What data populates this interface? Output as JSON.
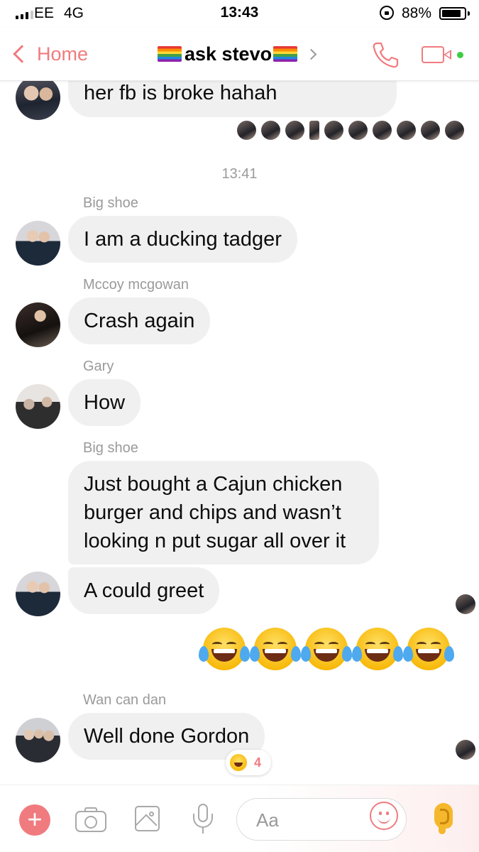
{
  "status_bar": {
    "carrier": "EE",
    "network": "4G",
    "time": "13:43",
    "battery": "88%",
    "battery_level": 0.88
  },
  "header": {
    "back_label": "Home",
    "title": "ask stevo",
    "accent_color": "#f07b7f",
    "online_color": "#3fcc45"
  },
  "chat": {
    "timestamp": "13:41",
    "messages": [
      {
        "sender": "",
        "text": "her fb is broke hahah"
      },
      {
        "sender": "Big shoe",
        "text": "I am a ducking tadger"
      },
      {
        "sender": "Mccoy mcgowan",
        "text": "Crash again"
      },
      {
        "sender": "Gary",
        "text": "How"
      },
      {
        "sender": "Big shoe",
        "text": "Just bought a Cajun chicken burger and chips and wasn’t looking n put sugar all over it"
      },
      {
        "sender": "",
        "text": "A could greet"
      },
      {
        "sender": "Wan can dan",
        "text": "Well done Gordon",
        "reaction_count": "4"
      }
    ],
    "outgoing_emojis": [
      "face-with-tears-of-joy",
      "face-with-tears-of-joy",
      "face-with-tears-of-joy",
      "face-with-tears-of-joy",
      "face-with-tears-of-joy"
    ]
  },
  "composer": {
    "placeholder": "Aa"
  }
}
